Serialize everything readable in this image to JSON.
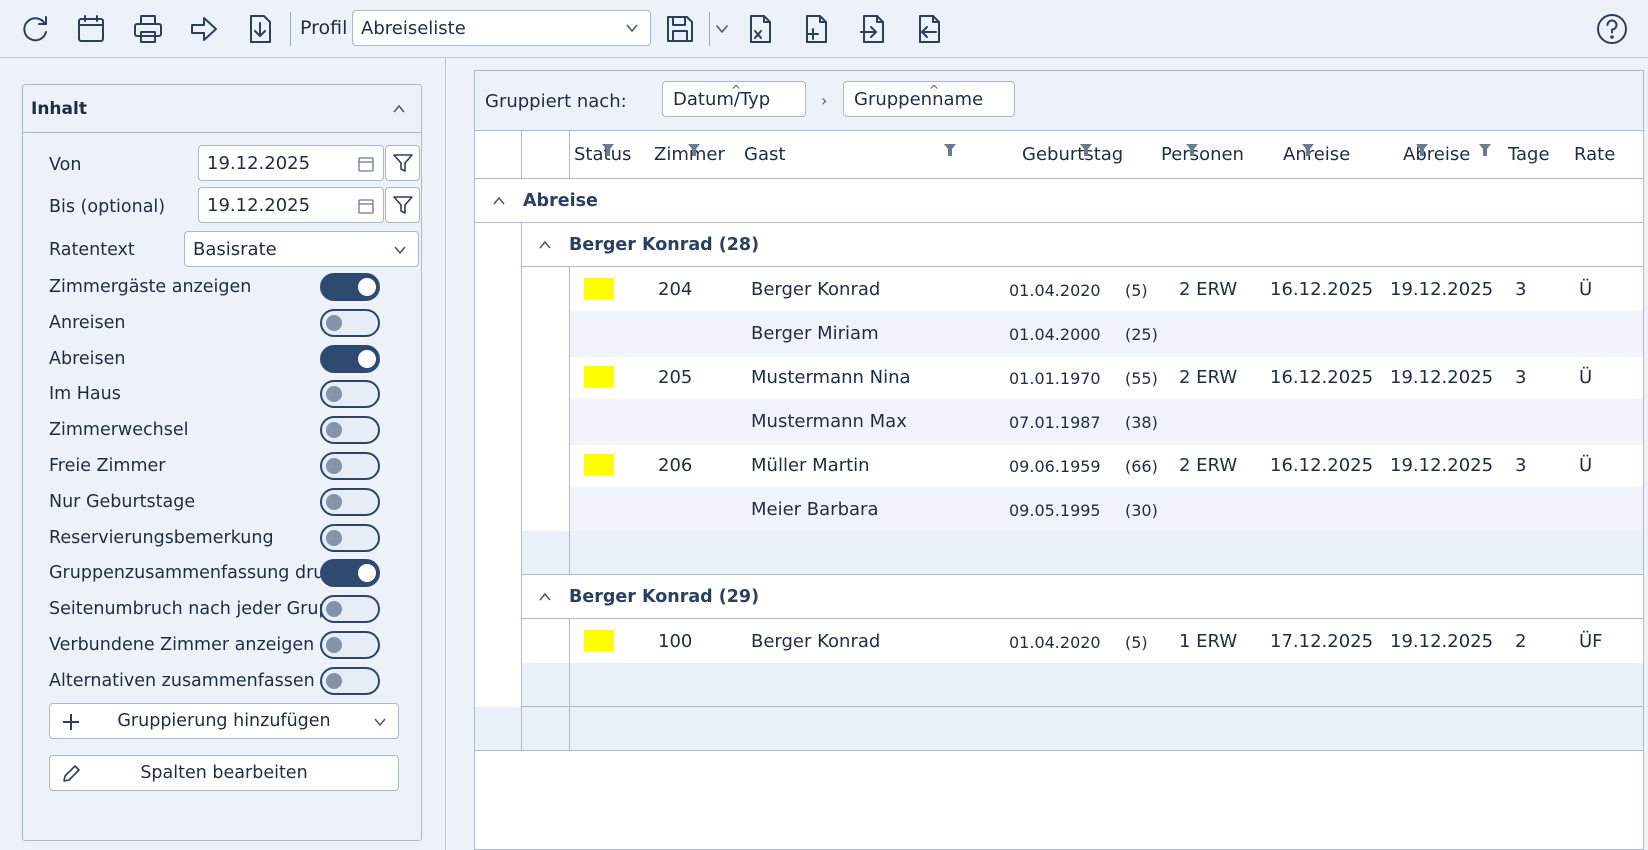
{
  "toolbar": {
    "icons": [
      "refresh-icon",
      "calendar-icon",
      "print-icon",
      "forward-icon",
      "download-icon",
      "save-icon",
      "chevron-down-icon",
      "file-excel-icon",
      "file-add-icon",
      "import-icon",
      "export-icon",
      "help-icon"
    ],
    "profil_label": "Profil",
    "profil_value": "Abreiseliste"
  },
  "panel": {
    "title": "Inhalt",
    "von_label": "Von",
    "von_value": "19.12.2025",
    "bis_label": "Bis (optional)",
    "bis_value": "19.12.2025",
    "ratentext_label": "Ratentext",
    "ratentext_value": "Basisrate",
    "toggles": [
      {
        "label": "Zimmergäste anzeigen",
        "on": true
      },
      {
        "label": "Anreisen",
        "on": false
      },
      {
        "label": "Abreisen",
        "on": true
      },
      {
        "label": "Im Haus",
        "on": false
      },
      {
        "label": "Zimmerwechsel",
        "on": false
      },
      {
        "label": "Freie Zimmer",
        "on": false
      },
      {
        "label": "Nur Geburtstage",
        "on": false
      },
      {
        "label": "Reservierungsbemerkung",
        "on": false
      },
      {
        "label": "Gruppenzusammenfassung drucken",
        "on": true
      },
      {
        "label": "Seitenumbruch nach jeder Gruppe",
        "on": false
      },
      {
        "label": "Verbundene Zimmer anzeigen",
        "on": false
      },
      {
        "label": "Alternativen zusammenfassen",
        "on": false
      }
    ],
    "add_grouping_label": "Gruppierung hinzufügen",
    "edit_columns_label": "Spalten bearbeiten"
  },
  "grid": {
    "grouped_by_label": "Gruppiert nach:",
    "chip1": "Datum/Typ",
    "chip2": "Gruppenname",
    "chip_separator": "›",
    "columns": {
      "status": "Status",
      "zimmer": "Zimmer",
      "gast": "Gast",
      "geburtstag": "Geburtstag",
      "personen": "Personen",
      "anreise": "Anreise",
      "abreise": "Abreise",
      "tage": "Tage",
      "rate": "Rate"
    },
    "top_group": "Abreise",
    "groups": [
      {
        "title": "Berger Konrad (28)",
        "rows": [
          {
            "status": true,
            "zimmer": "204",
            "gast": "Berger Konrad",
            "geburtstag": "01.04.2020",
            "alter": "(5)",
            "personen": "2 ERW",
            "anreise": "16.12.2025",
            "abreise": "19.12.2025",
            "tage": "3",
            "rate": "Ü"
          },
          {
            "status": false,
            "zimmer": "",
            "gast": "Berger Miriam",
            "geburtstag": "01.04.2000",
            "alter": "(25)",
            "personen": "",
            "anreise": "",
            "abreise": "",
            "tage": "",
            "rate": ""
          },
          {
            "status": true,
            "zimmer": "205",
            "gast": "Mustermann Nina",
            "geburtstag": "01.01.1970",
            "alter": "(55)",
            "personen": "2 ERW",
            "anreise": "16.12.2025",
            "abreise": "19.12.2025",
            "tage": "3",
            "rate": "Ü"
          },
          {
            "status": false,
            "zimmer": "",
            "gast": "Mustermann Max",
            "geburtstag": "07.01.1987",
            "alter": "(38)",
            "personen": "",
            "anreise": "",
            "abreise": "",
            "tage": "",
            "rate": ""
          },
          {
            "status": true,
            "zimmer": "206",
            "gast": "Müller Martin",
            "geburtstag": "09.06.1959",
            "alter": "(66)",
            "personen": "2 ERW",
            "anreise": "16.12.2025",
            "abreise": "19.12.2025",
            "tage": "3",
            "rate": "Ü"
          },
          {
            "status": false,
            "zimmer": "",
            "gast": "Meier Barbara",
            "geburtstag": "09.05.1995",
            "alter": "(30)",
            "personen": "",
            "anreise": "",
            "abreise": "",
            "tage": "",
            "rate": ""
          }
        ]
      },
      {
        "title": "Berger Konrad (29)",
        "rows": [
          {
            "status": true,
            "zimmer": "100",
            "gast": "Berger Konrad",
            "geburtstag": "01.04.2020",
            "alter": "(5)",
            "personen": "1 ERW",
            "anreise": "17.12.2025",
            "abreise": "19.12.2025",
            "tage": "2",
            "rate": "ÜF"
          }
        ]
      }
    ]
  },
  "colors": {
    "accent": "#2f4a70",
    "status_yellow": "#ffff00",
    "background": "#edf1f8"
  }
}
